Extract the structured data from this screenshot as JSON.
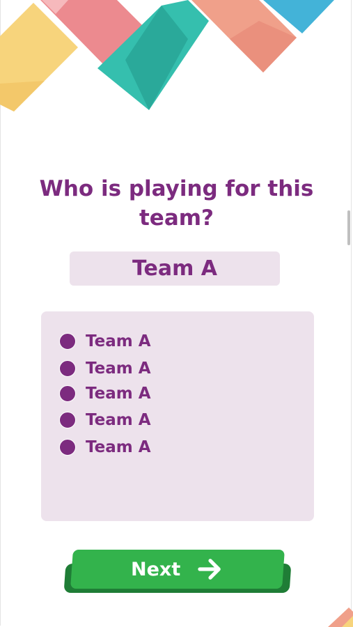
{
  "question": "Who is playing for this team?",
  "team_label": "Team A",
  "options": [
    {
      "label": "Team A"
    },
    {
      "label": "Team A"
    },
    {
      "label": "Team A"
    },
    {
      "label": "Team A"
    },
    {
      "label": "Team A"
    }
  ],
  "next_button": {
    "label": "Next",
    "icon": "arrow-right-icon"
  },
  "colors": {
    "primary_purple": "#7c2b7f",
    "panel_background": "#ede2ec",
    "button_green": "#33b34c",
    "button_green_dark": "#1f7d36",
    "tile_yellow": "#f7d47c",
    "tile_pink": "#ec8a8f",
    "tile_teal": "#35bfae",
    "tile_salmon": "#f0a08a",
    "tile_blue": "#43b3d8"
  }
}
